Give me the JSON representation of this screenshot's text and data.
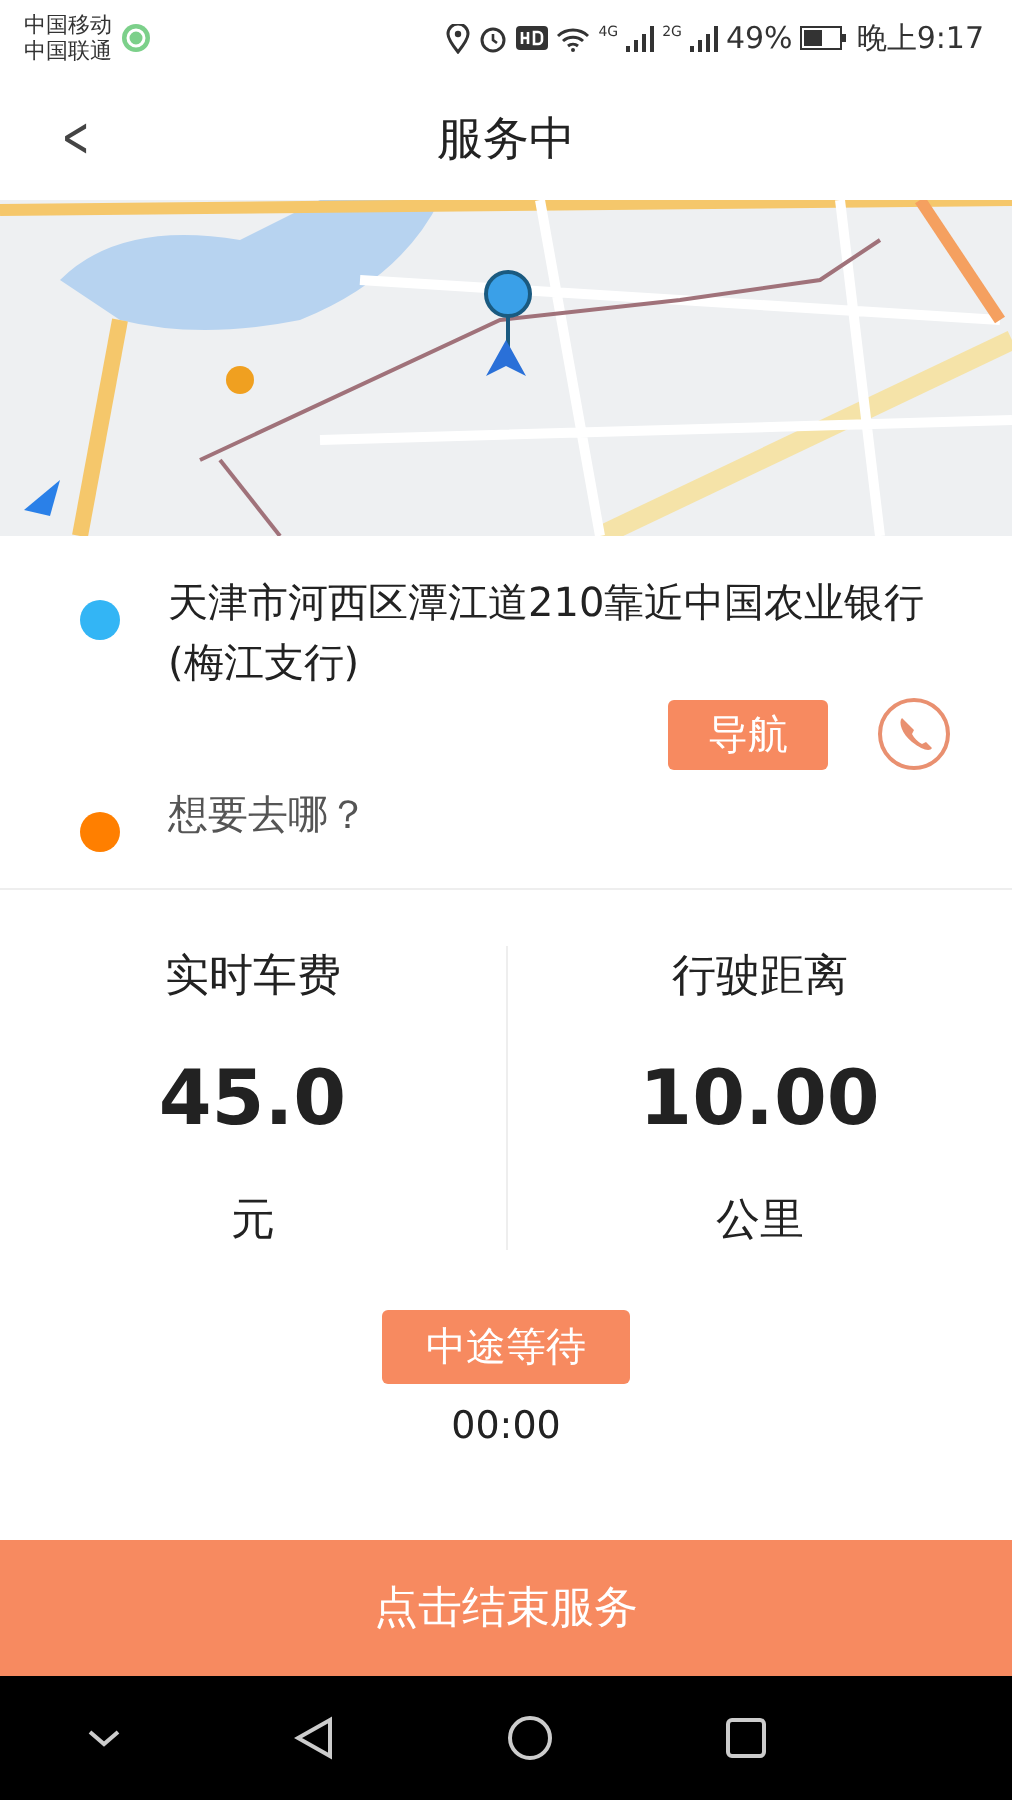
{
  "status_bar": {
    "carriers": [
      "中国移动",
      "中国联通"
    ],
    "networks": [
      "4G",
      "2G"
    ],
    "battery": "49%",
    "time": "晚上9:17"
  },
  "header": {
    "back": "<",
    "title": "服务中"
  },
  "addresses": [
    {
      "kind": "start",
      "color": "#33b5f5",
      "text": "天津市河西区潭江道210靠近中国农业银行(梅江支行)"
    },
    {
      "kind": "destination",
      "color": "#ff7f00",
      "text": "想要去哪？"
    }
  ],
  "navigate_button": "导航",
  "stats": [
    {
      "label": "实时车费",
      "value": "45.0",
      "unit": "元"
    },
    {
      "label": "行驶距离",
      "value": "10.00",
      "unit": "公里"
    }
  ],
  "wait": {
    "button": "中途等待",
    "time": "00:00"
  },
  "end_button": "点击结束服务"
}
